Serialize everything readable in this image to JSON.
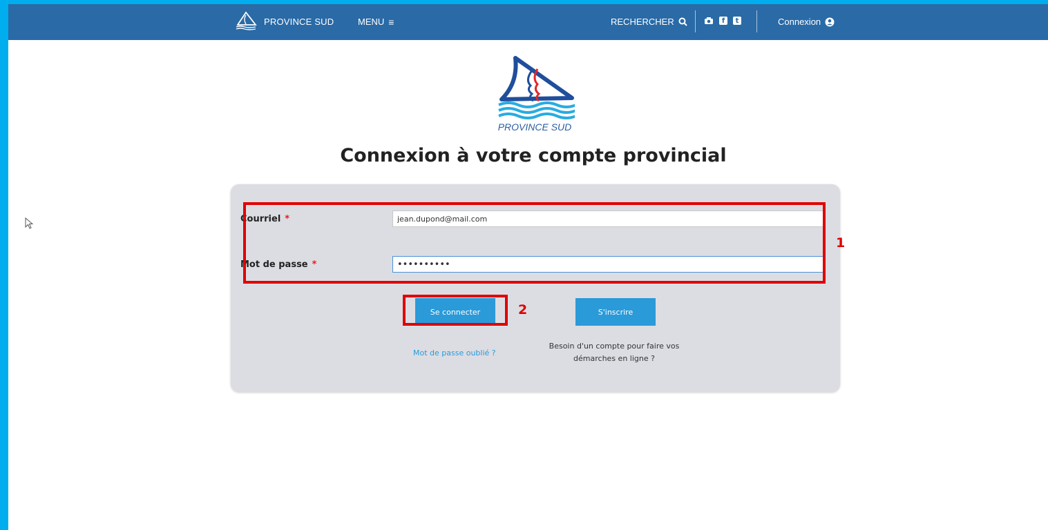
{
  "navbar": {
    "brand": "PROVINCE SUD",
    "menu_label": "MENU",
    "search_label": "RECHERCHER",
    "login_label": "Connexion",
    "social_icons": [
      "camera-icon",
      "facebook-icon",
      "twitter-icon"
    ]
  },
  "logo": {
    "caption": "PROVINCE SUD"
  },
  "page_title": "Connexion à votre compte provincial",
  "form": {
    "email_label": "Courriel",
    "email_value": "jean.dupond@mail.com",
    "password_label": "Mot de passe",
    "password_value": "••••••••••",
    "required_mark": "*",
    "login_button": "Se connecter",
    "register_button": "S'inscrire",
    "forgot_password_link": "Mot de passe oublié ?",
    "help_text_line1": "Besoin d'un compte pour faire vos",
    "help_text_line2": "démarches en ligne ?"
  },
  "annotations": {
    "box1_number": "1",
    "box2_number": "2"
  },
  "colors": {
    "navbar": "#2a6aa6",
    "accent": "#2a9ad9",
    "annotation": "#e10000",
    "frame": "#00aeef"
  }
}
